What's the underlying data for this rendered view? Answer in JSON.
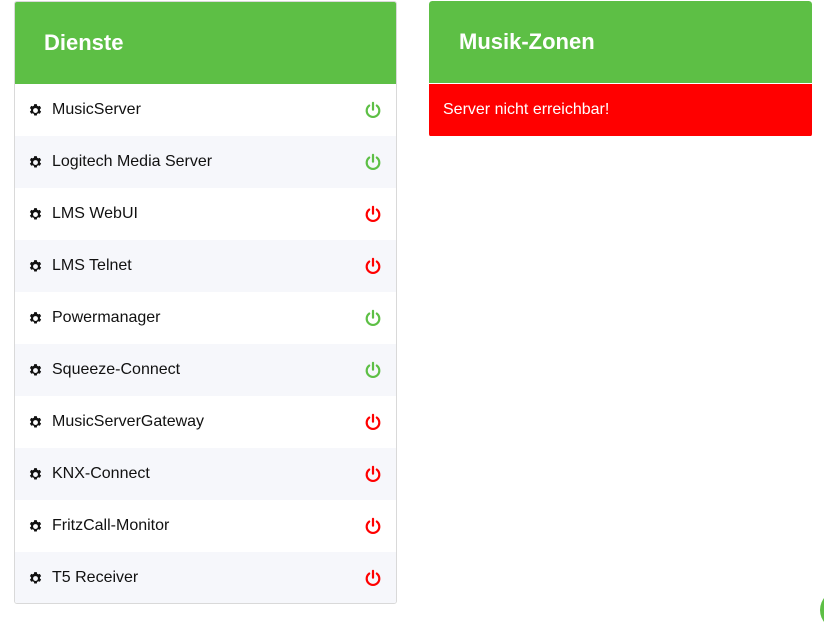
{
  "colors": {
    "header_green": "#5dbf45",
    "status_on": "#5dbf45",
    "status_off": "#ff0000",
    "error_red": "#ff0000"
  },
  "dienste": {
    "title": "Dienste",
    "services": [
      {
        "name": "MusicServer",
        "icon": "gear-icon",
        "status": "on"
      },
      {
        "name": "Logitech Media Server",
        "icon": "gear-icon",
        "status": "on"
      },
      {
        "name": "LMS WebUI",
        "icon": "gear-icon",
        "status": "off"
      },
      {
        "name": "LMS Telnet",
        "icon": "gear-icon",
        "status": "off"
      },
      {
        "name": "Powermanager",
        "icon": "gear-icon",
        "status": "on"
      },
      {
        "name": "Squeeze-Connect",
        "icon": "gear-icon",
        "status": "on"
      },
      {
        "name": "MusicServerGateway",
        "icon": "gear-icon",
        "status": "off"
      },
      {
        "name": "KNX-Connect",
        "icon": "gear-icon",
        "status": "off"
      },
      {
        "name": "FritzCall-Monitor",
        "icon": "gear-icon",
        "status": "off"
      },
      {
        "name": "T5 Receiver",
        "icon": "gear-icon",
        "status": "off"
      }
    ]
  },
  "zonen": {
    "title": "Musik-Zonen",
    "error_message": "Server nicht erreichbar!"
  }
}
